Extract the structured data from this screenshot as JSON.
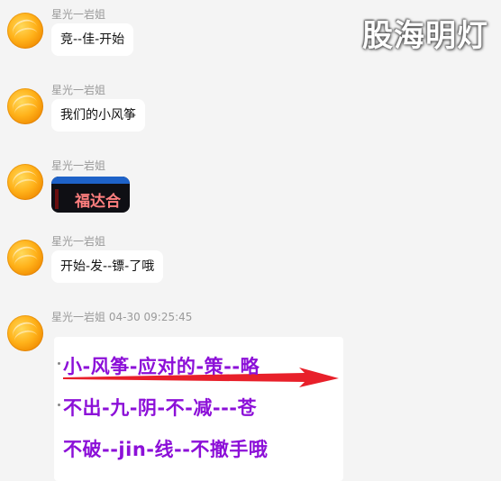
{
  "watermark": "股海明灯",
  "messages": [
    {
      "sender": "星光一岩姐",
      "text": "竞--佳-开始"
    },
    {
      "sender": "星光一岩姐",
      "text": "我们的小风筝"
    },
    {
      "sender": "星光一岩姐",
      "sticker_text": "福达合"
    },
    {
      "sender": "星光一岩姐",
      "text": "开始-发--镖-了哦"
    },
    {
      "sender": "星光一岩姐",
      "timestamp": "04-30 09:25:45",
      "image_lines": [
        "小-风筝-应对的-策--略",
        "不出-九-阴-不-减---苍",
        "不破--jin-线--不撤手哦"
      ]
    }
  ],
  "colors": {
    "background": "#f4f4f4",
    "bubble": "#ffffff",
    "sender_text": "#9a9a9a",
    "image_text_purple": "#8c10d8",
    "arrow_red": "#e8202a",
    "sticker_blue": "#1e62c8",
    "sticker_text": "#ff7f7f"
  },
  "icons": {
    "avatar": "orange-circle-avatar-icon",
    "arrow": "red-right-arrow-icon"
  }
}
